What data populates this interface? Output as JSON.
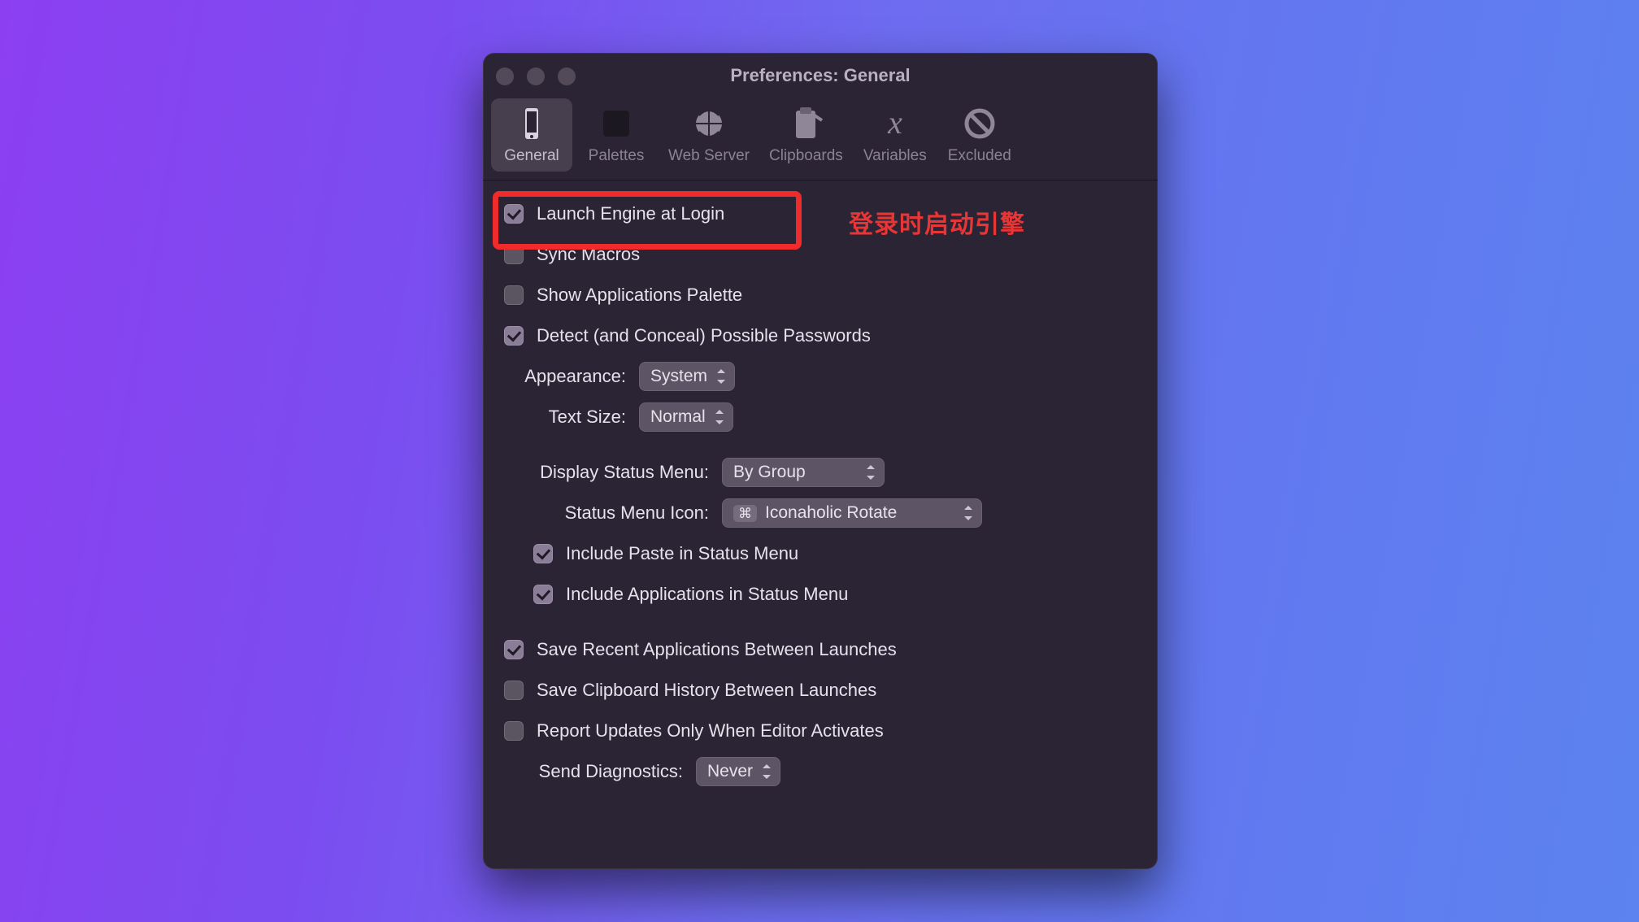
{
  "window": {
    "title": "Preferences: General"
  },
  "toolbar": {
    "tabs": [
      {
        "label": "General",
        "icon": "phone-icon",
        "selected": true
      },
      {
        "label": "Palettes",
        "icon": "palette-icon",
        "selected": false
      },
      {
        "label": "Web Server",
        "icon": "globe-icon",
        "selected": false
      },
      {
        "label": "Clipboards",
        "icon": "clipboard-icon",
        "selected": false
      },
      {
        "label": "Variables",
        "icon": "variable-icon",
        "selected": false
      },
      {
        "label": "Excluded",
        "icon": "excluded-icon",
        "selected": false
      }
    ]
  },
  "checks": {
    "launch_login": {
      "label": "Launch Engine at Login",
      "checked": true
    },
    "sync_macros": {
      "label": "Sync Macros",
      "checked": false
    },
    "show_app_pal": {
      "label": "Show Applications Palette",
      "checked": false
    },
    "detect_pw": {
      "label": "Detect (and Conceal) Possible Passwords",
      "checked": true
    },
    "inc_paste": {
      "label": "Include Paste in Status Menu",
      "checked": true
    },
    "inc_apps": {
      "label": "Include Applications in Status Menu",
      "checked": true
    },
    "save_recent": {
      "label": "Save Recent Applications Between Launches",
      "checked": true
    },
    "save_clip": {
      "label": "Save Clipboard History Between Launches",
      "checked": false
    },
    "report_updates": {
      "label": "Report Updates Only When Editor Activates",
      "checked": false
    }
  },
  "selects": {
    "appearance": {
      "label": "Appearance:",
      "value": "System"
    },
    "text_size": {
      "label": "Text Size:",
      "value": "Normal"
    },
    "display_status": {
      "label": "Display Status Menu:",
      "value": "By Group"
    },
    "status_icon": {
      "label": "Status Menu Icon:",
      "value": "Iconaholic Rotate",
      "kbd": "⌘"
    },
    "send_diag": {
      "label": "Send Diagnostics:",
      "value": "Never"
    }
  },
  "annotation": {
    "text": "登录时启动引擎"
  },
  "colors": {
    "highlight": "#ef2b2b",
    "window_bg": "#2b2434",
    "text": "#e7e1ec"
  }
}
